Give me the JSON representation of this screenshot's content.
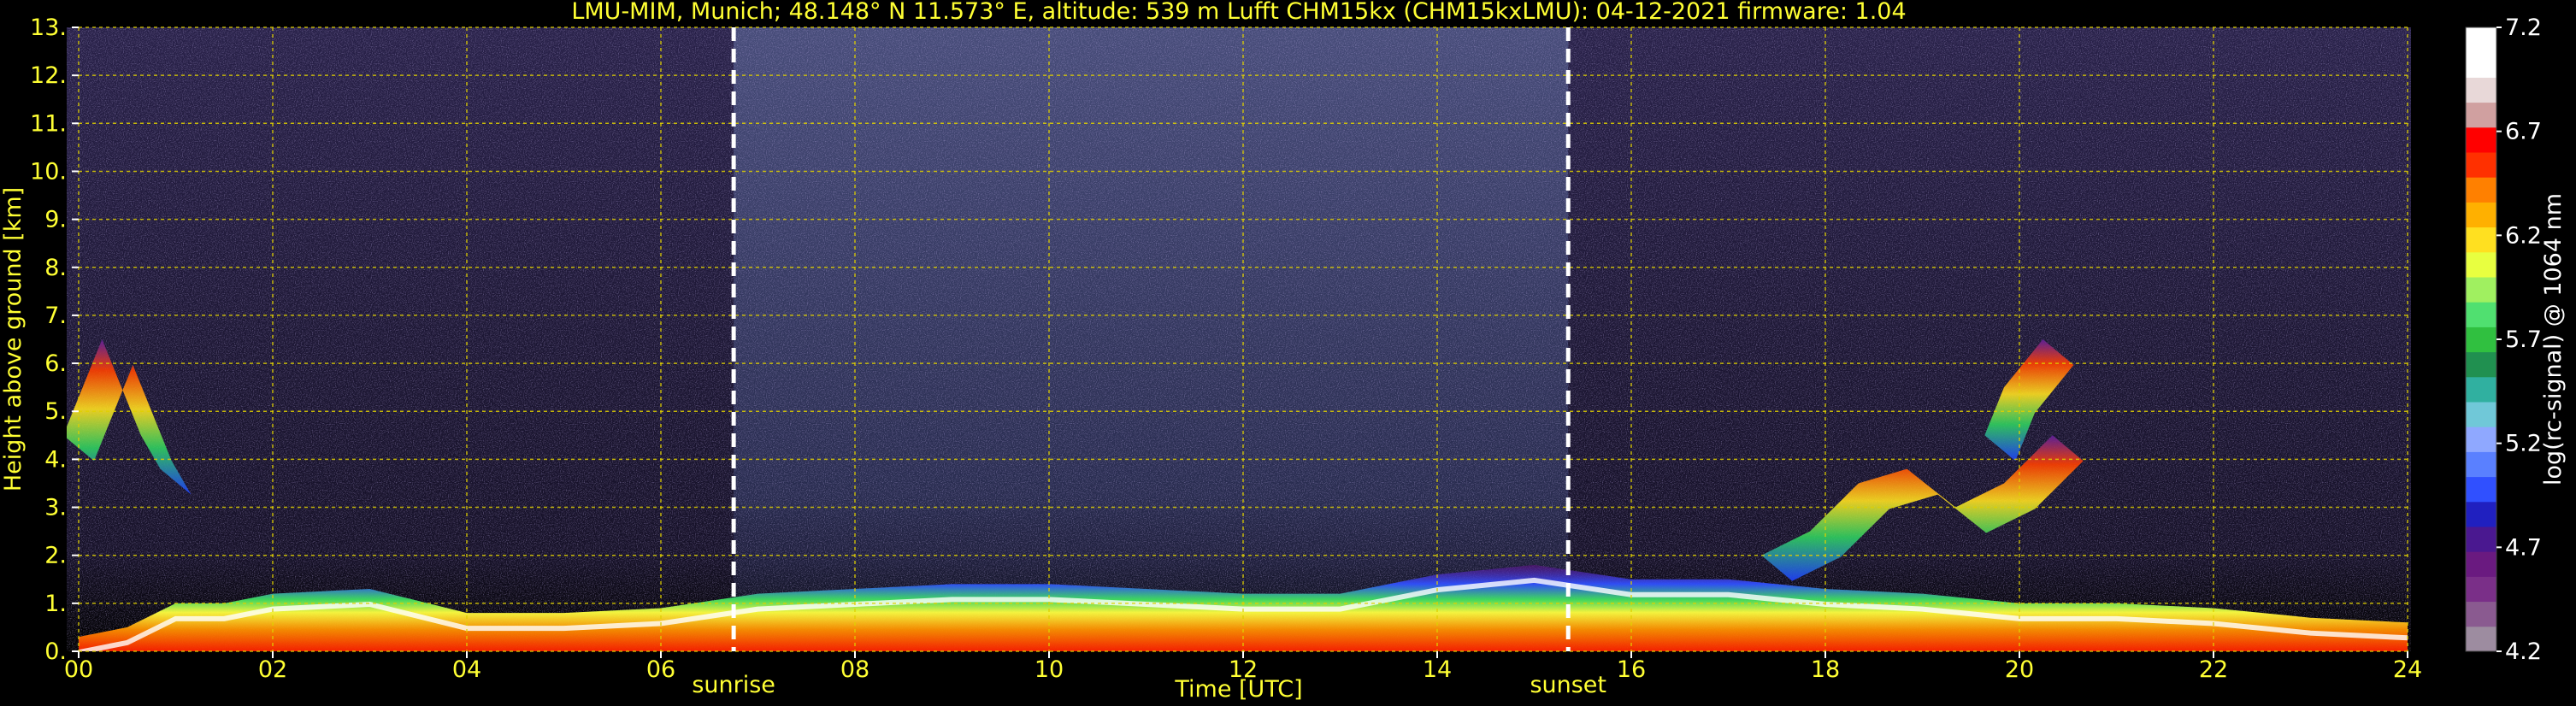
{
  "chart_data": {
    "type": "heatmap",
    "title": "LMU-MIM, Munich; 48.148° N 11.573° E, altitude: 539 m    Lufft CHM15kx (CHM15kxLMU): 04-12-2021    firmware: 1.04",
    "xlabel": "Time [UTC]",
    "ylabel": "Height above ground [km]",
    "x_ticks": [
      "00",
      "02",
      "04",
      "06",
      "08",
      "10",
      "12",
      "14",
      "16",
      "18",
      "20",
      "22",
      "24"
    ],
    "y_ticks": [
      "0.",
      "1.",
      "2.",
      "3.",
      "4.",
      "5.",
      "6.",
      "7.",
      "8.",
      "9.",
      "10.",
      "11.",
      "12.",
      "13."
    ],
    "xlim": [
      0,
      24
    ],
    "ylim": [
      0,
      13
    ],
    "grid": true,
    "events": [
      {
        "label": "sunrise",
        "time": 6.75
      },
      {
        "label": "sunset",
        "time": 15.35
      }
    ],
    "colorbar": {
      "label": "log(rc-signal) @ 1064 nm",
      "range": [
        4.2,
        7.2
      ],
      "ticks": [
        "4.2",
        "4.7",
        "5.2",
        "5.7",
        "6.2",
        "6.7",
        "7.2"
      ]
    },
    "layers": [
      {
        "name": "boundary-layer",
        "t": [
          0.0,
          0.5,
          1.0,
          1.5,
          2.0,
          3.0,
          4.0,
          5.0,
          6.0,
          7.0,
          8.0,
          9.0,
          10.0,
          11.0,
          12.0,
          13.0,
          14.0,
          15.0,
          16.0,
          17.0,
          18.0,
          19.0,
          20.0,
          21.0,
          22.0,
          23.0,
          24.0
        ],
        "h": [
          0.3,
          0.5,
          1.0,
          1.0,
          1.2,
          1.3,
          0.8,
          0.8,
          0.9,
          1.2,
          1.3,
          1.4,
          1.4,
          1.3,
          1.2,
          1.2,
          1.6,
          1.8,
          1.5,
          1.5,
          1.3,
          1.2,
          1.0,
          1.0,
          0.9,
          0.7,
          0.6
        ]
      },
      {
        "name": "elevated-layer",
        "t": [
          17.5,
          18.0,
          18.5,
          19.0,
          19.5,
          20.0,
          20.5
        ],
        "h": [
          2.0,
          2.5,
          3.5,
          3.8,
          3.0,
          3.5,
          4.5
        ]
      },
      {
        "name": "cirrus-early",
        "t": [
          0.0,
          0.2,
          0.4,
          0.6,
          0.8,
          1.0
        ],
        "h": [
          4.5,
          5.5,
          6.5,
          5.5,
          4.5,
          3.8
        ]
      },
      {
        "name": "cirrus-evening",
        "t": [
          19.8,
          20.0,
          20.2,
          20.4
        ],
        "h": [
          4.5,
          5.5,
          6.0,
          6.5
        ]
      }
    ]
  }
}
